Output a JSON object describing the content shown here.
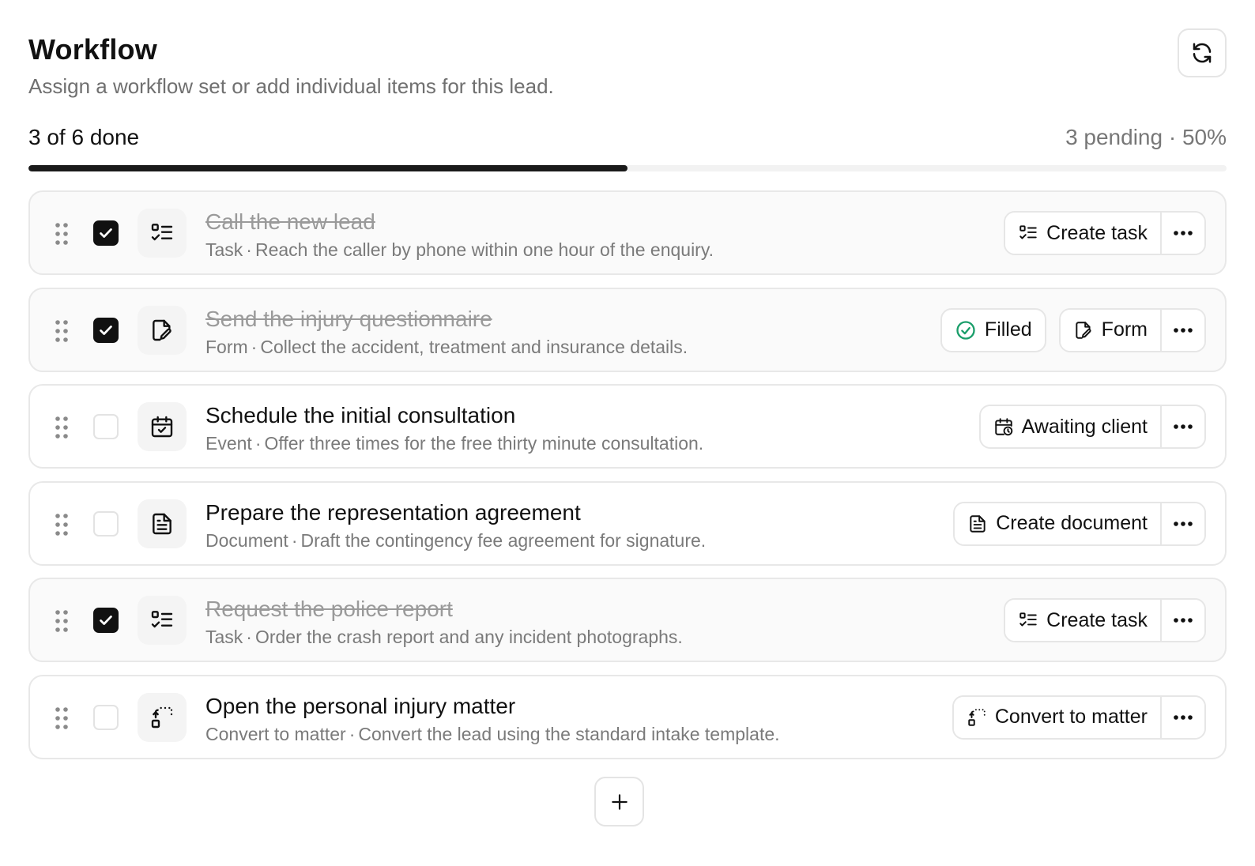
{
  "header": {
    "title": "Workflow",
    "subtitle": "Assign a workflow set or add individual items for this lead."
  },
  "progress": {
    "done_label": "3 of 6 done",
    "stats_label": "3 pending · 50%",
    "fraction": 0.5
  },
  "items": [
    {
      "title": "Call the new lead",
      "type": "Task",
      "description": "Reach the caller by phone within one hour of the enquiry.",
      "done": true,
      "icon": "task-list-icon",
      "actions": [
        {
          "label": "Create task",
          "icon": "task-list-icon"
        }
      ]
    },
    {
      "title": "Send the injury questionnaire",
      "type": "Form",
      "description": "Collect the accident, treatment and insurance details.",
      "done": true,
      "icon": "form-edit-icon",
      "badge": {
        "label": "Filled",
        "icon": "check-circle-icon",
        "color": "#1a9e6a"
      },
      "actions": [
        {
          "label": "Form",
          "icon": "form-edit-icon"
        }
      ]
    },
    {
      "title": "Schedule the initial consultation",
      "type": "Event",
      "description": "Offer three times for the free thirty minute consultation.",
      "done": false,
      "icon": "calendar-check-icon",
      "actions": [
        {
          "label": "Awaiting client",
          "icon": "calendar-clock-icon"
        }
      ]
    },
    {
      "title": "Prepare the representation agreement",
      "type": "Document",
      "description": "Draft the contingency fee agreement for signature.",
      "done": false,
      "icon": "document-icon",
      "actions": [
        {
          "label": "Create document",
          "icon": "document-icon"
        }
      ]
    },
    {
      "title": "Request the police report",
      "type": "Task",
      "description": "Order the crash report and any incident photographs.",
      "done": true,
      "icon": "task-list-icon",
      "actions": [
        {
          "label": "Create task",
          "icon": "task-list-icon"
        }
      ]
    },
    {
      "title": "Open the personal injury matter",
      "type": "Convert to matter",
      "description": "Convert the lead using the standard intake template.",
      "done": false,
      "icon": "convert-icon",
      "actions": [
        {
          "label": "Convert to matter",
          "icon": "convert-icon"
        }
      ]
    }
  ],
  "colors": {
    "accent": "#111111",
    "success": "#1a9e6a",
    "muted_text": "#7a7a7a"
  }
}
